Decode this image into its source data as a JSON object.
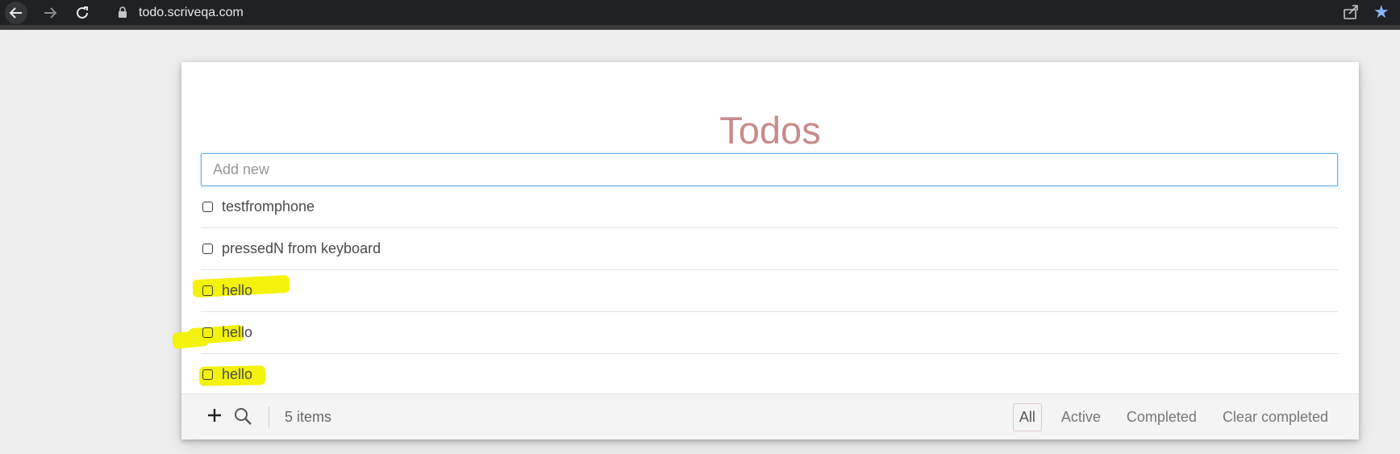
{
  "browser": {
    "url": "todo.scriveqa.com",
    "back_icon": "back-arrow-icon",
    "forward_icon": "forward-arrow-icon",
    "reload_icon": "reload-icon",
    "lock_icon": "lock-icon",
    "share_icon": "share-icon",
    "bookmark_icon": "star-icon"
  },
  "app": {
    "title": "Todos",
    "input_placeholder": "Add new",
    "input_value": ""
  },
  "todos": [
    {
      "text": "testfromphone",
      "completed": false,
      "highlighted": false
    },
    {
      "text": "pressedN from keyboard",
      "completed": false,
      "highlighted": false
    },
    {
      "text": "hello",
      "completed": false,
      "highlighted": true
    },
    {
      "text": "hello",
      "completed": false,
      "highlighted": true
    },
    {
      "text": "hello",
      "completed": false,
      "highlighted": true
    }
  ],
  "footer": {
    "count_label": "5 items",
    "filters": [
      "All",
      "Active",
      "Completed"
    ],
    "active_filter": "All",
    "clear_label": "Clear completed"
  },
  "colors": {
    "title": "#c78b8b",
    "highlight": "#f2f20a",
    "input_focus": "#66afe9"
  }
}
